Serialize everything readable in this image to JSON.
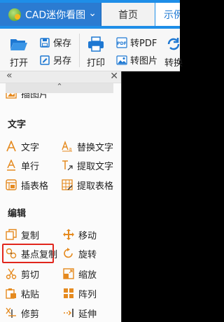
{
  "tabs": {
    "app": "CAD迷你看图",
    "home": "首页",
    "sample": "示例"
  },
  "ribbon": {
    "open": "打开",
    "save": "保存",
    "save_as": "另存",
    "print": "打印",
    "to_pdf": "转PDF",
    "to_image": "转图片",
    "convert": "转换"
  },
  "panel": {
    "cut_item": "插图片",
    "sections": {
      "text": "文字",
      "edit": "编辑"
    },
    "text_items": {
      "text": "文字",
      "replace_text": "替换文字",
      "single_line": "单行",
      "extract_text": "提取文字",
      "insert_table": "插表格",
      "extract_table": "提取表格"
    },
    "edit_items": {
      "copy": "复制",
      "move": "移动",
      "base_copy": "基点复制",
      "rotate": "旋转",
      "cut": "剪切",
      "scale": "缩放",
      "paste": "粘贴",
      "array": "阵列",
      "trim": "修剪",
      "extend": "延伸"
    }
  },
  "colors": {
    "titlebar": "#1e8ee8",
    "highlight": "#e1261c",
    "icon_orange": "#e58a1f",
    "icon_blue": "#2b7bd1"
  }
}
